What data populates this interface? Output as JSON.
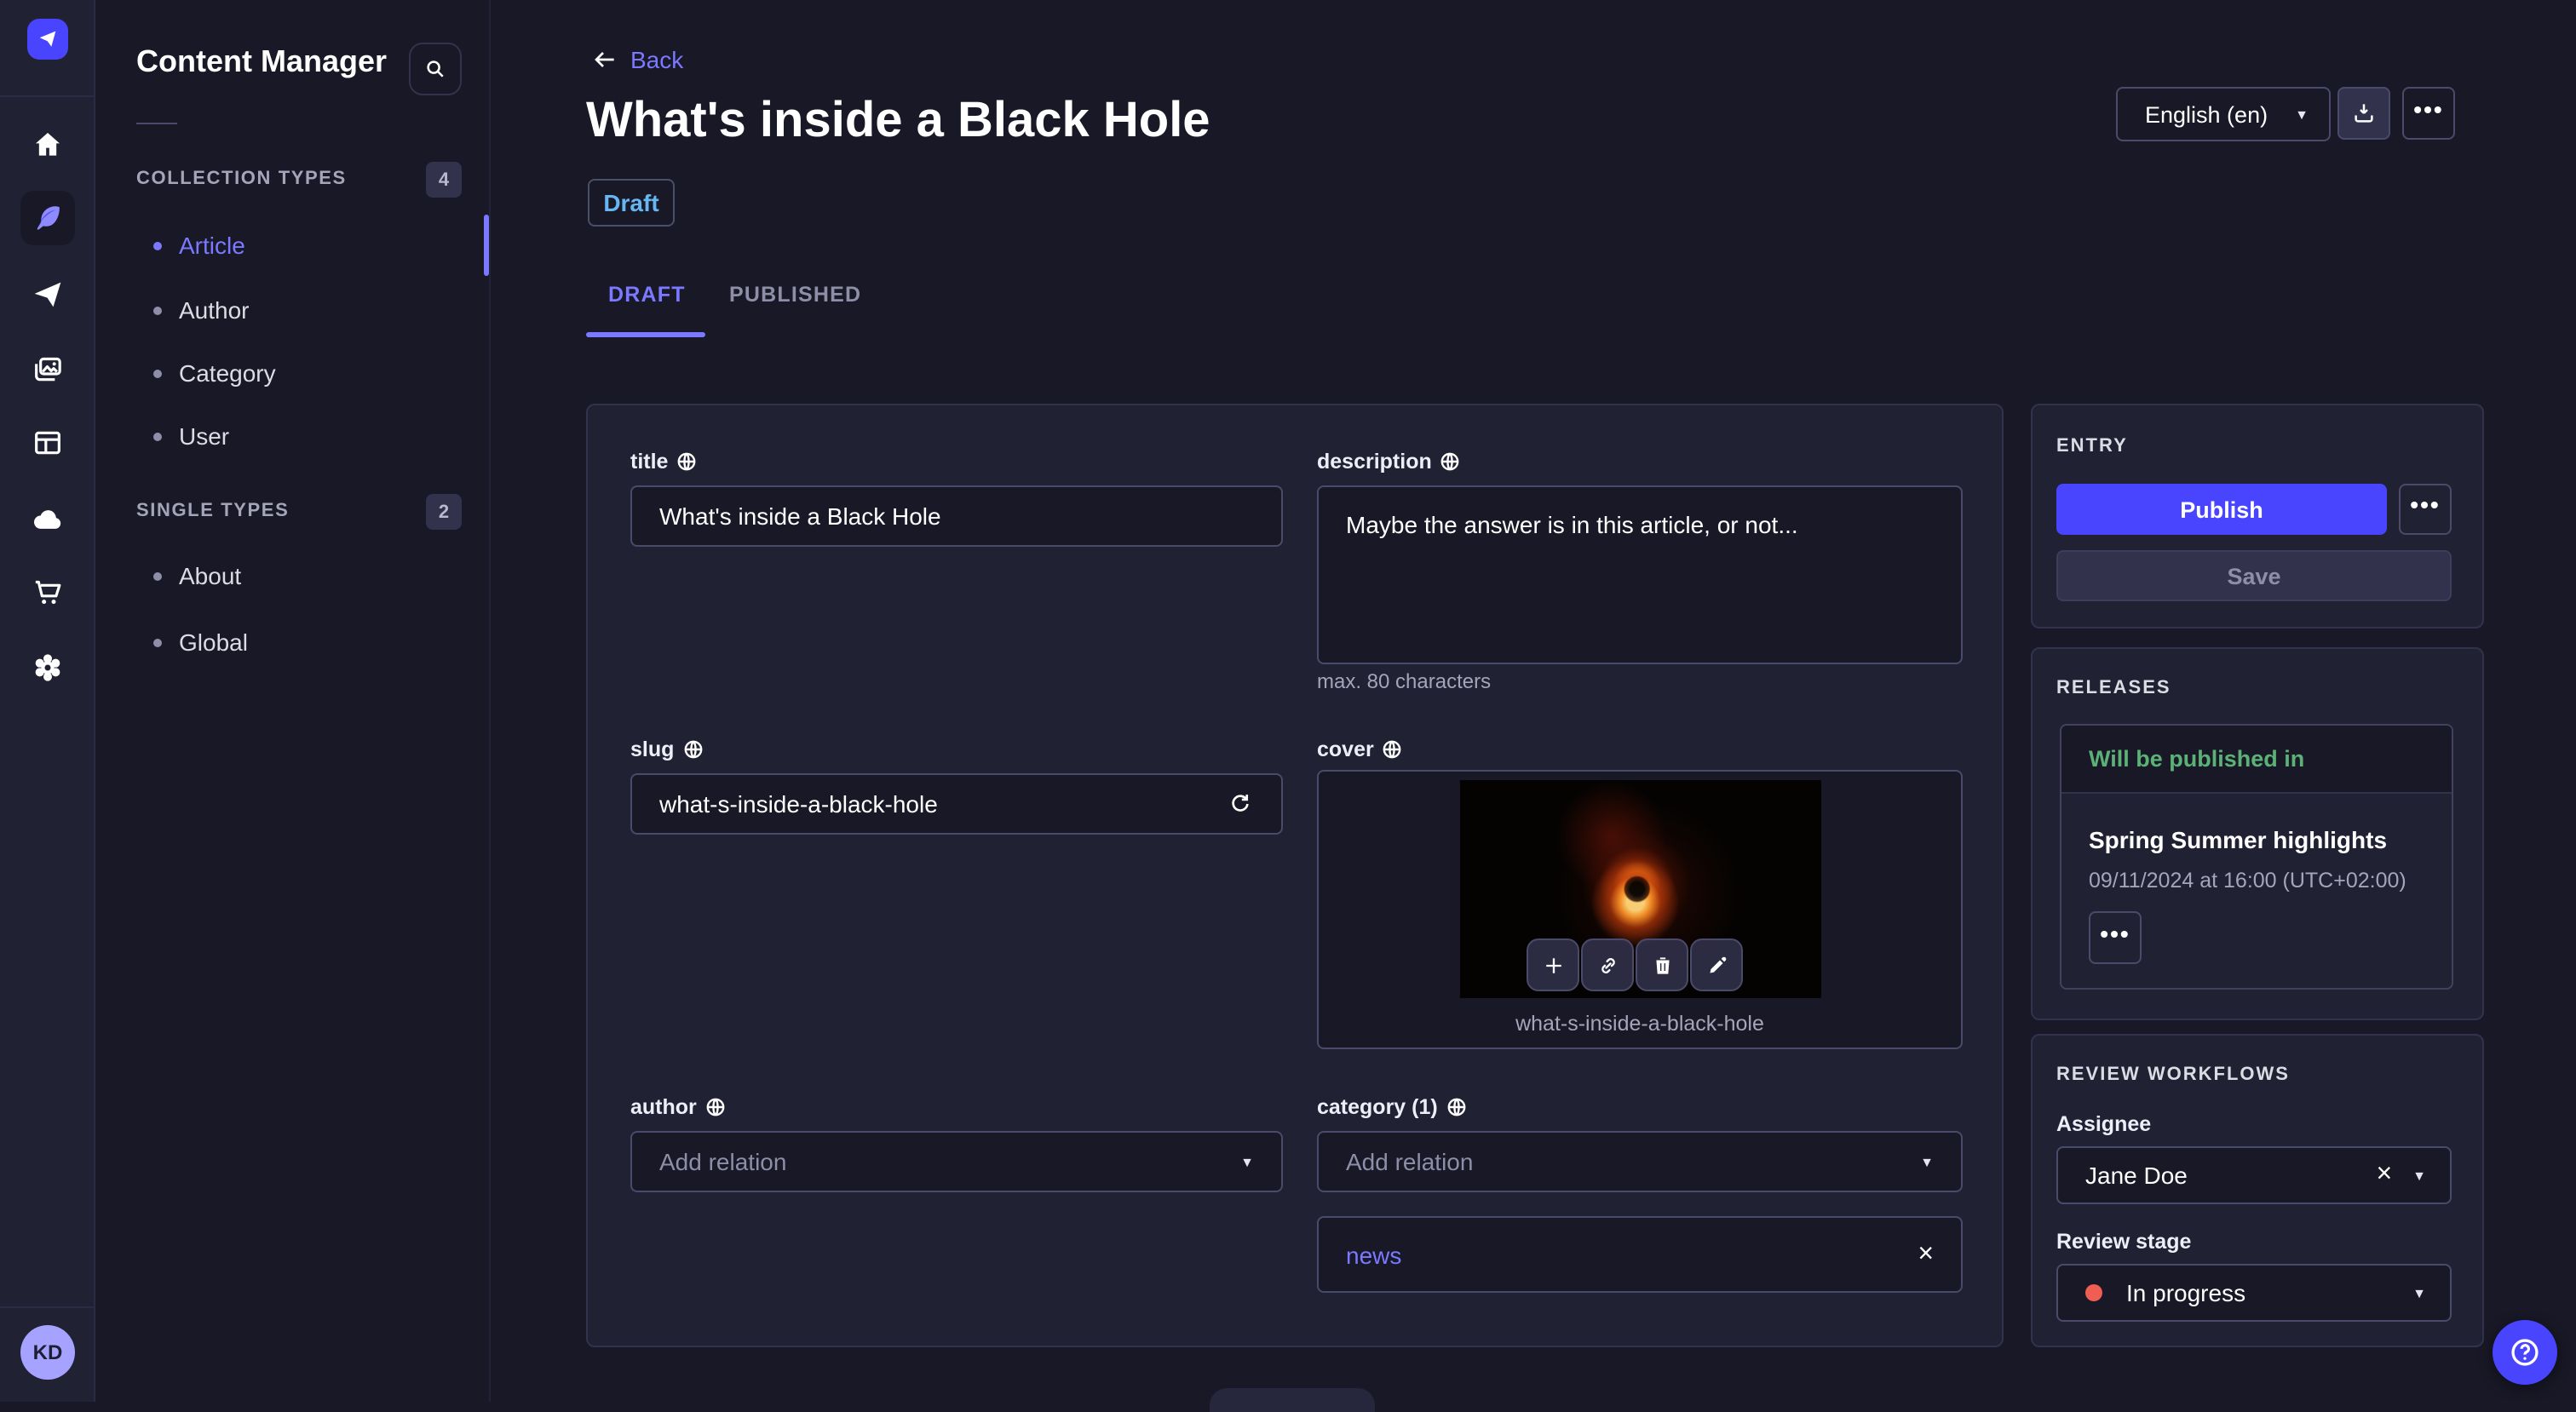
{
  "theme": {
    "accent": "#4945ff",
    "accent_light": "#7b79ff",
    "success_green": "#5cb176",
    "danger_red": "#ee5e52",
    "draft_blue": "#66b7f1",
    "page_bg": "#181826",
    "card_bg": "#212134"
  },
  "appbar": {
    "logo_icon": "strapi-logo",
    "nav_icons": [
      {
        "icon": "home"
      },
      {
        "icon": "feather",
        "active": true
      },
      {
        "icon": "paper-plane"
      },
      {
        "icon": "media-library"
      },
      {
        "icon": "layout"
      },
      {
        "icon": "cloud"
      },
      {
        "icon": "cart"
      },
      {
        "icon": "settings"
      }
    ],
    "avatar_initials": "KD"
  },
  "subnav": {
    "title": "Content Manager",
    "search_icon": "search",
    "sections": [
      {
        "label": "COLLECTION TYPES",
        "count": "4",
        "items": [
          {
            "label": "Article",
            "active": true
          },
          {
            "label": "Author"
          },
          {
            "label": "Category"
          },
          {
            "label": "User"
          }
        ]
      },
      {
        "label": "SINGLE TYPES",
        "count": "2",
        "items": [
          {
            "label": "About"
          },
          {
            "label": "Global"
          }
        ]
      }
    ]
  },
  "header": {
    "back_label": "Back",
    "title": "What's inside a Black Hole",
    "status": "Draft",
    "tabs": [
      {
        "label": "DRAFT",
        "active": true
      },
      {
        "label": "PUBLISHED"
      }
    ],
    "locale": "English (en)",
    "download_icon": "download",
    "more_label": "•••"
  },
  "form": {
    "title": {
      "label": "title",
      "value": "What's inside a Black Hole"
    },
    "description": {
      "label": "description",
      "value": "Maybe the answer is in this article, or not...",
      "helper": "max. 80 characters"
    },
    "slug": {
      "label": "slug",
      "value": "what-s-inside-a-black-hole",
      "refresh_icon": "regenerate"
    },
    "cover": {
      "label": "cover",
      "caption": "what-s-inside-a-black-hole",
      "actions": [
        "add",
        "copy-link",
        "delete",
        "edit"
      ]
    },
    "author": {
      "label": "author",
      "placeholder": "Add relation"
    },
    "category": {
      "label": "category (1)",
      "placeholder": "Add relation",
      "tag": "news"
    }
  },
  "entry_panel": {
    "title": "ENTRY",
    "publish_label": "Publish",
    "save_label": "Save",
    "more_label": "•••"
  },
  "releases_panel": {
    "title": "RELEASES",
    "status": "Will be published in",
    "release_name": "Spring Summer highlights",
    "release_date": "09/11/2024 at 16:00 (UTC+02:00)",
    "more_label": "•••"
  },
  "review_panel": {
    "title": "REVIEW WORKFLOWS",
    "assignee_label": "Assignee",
    "assignee_value": "Jane Doe",
    "stage_label": "Review stage",
    "stage_value": "In progress"
  },
  "fab": {
    "icon": "help-question"
  }
}
